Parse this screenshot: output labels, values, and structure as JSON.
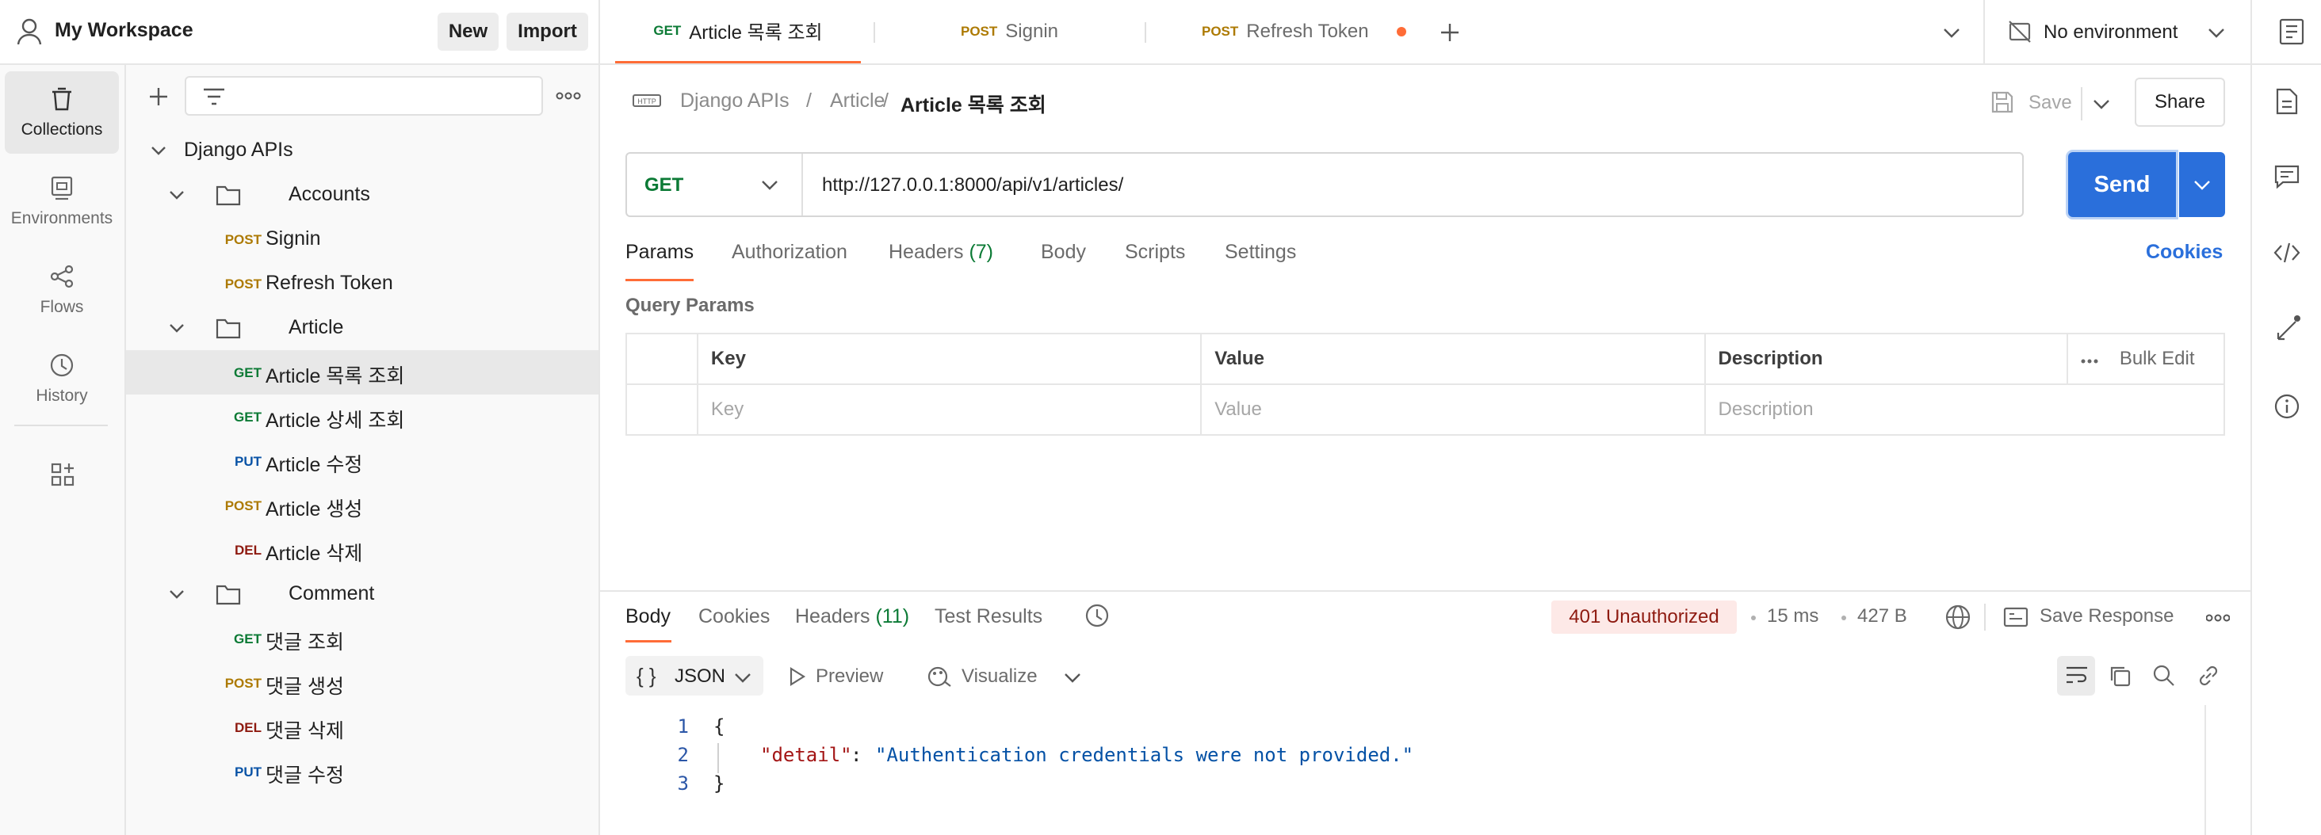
{
  "workspace": {
    "name": "My Workspace",
    "new_label": "New",
    "import_label": "Import"
  },
  "tabs": [
    {
      "method": "GET",
      "label": "Article 목록 조회"
    },
    {
      "method": "POST",
      "label": "Signin"
    },
    {
      "method": "POST",
      "label": "Refresh Token"
    }
  ],
  "environment": {
    "label": "No environment"
  },
  "rail": [
    {
      "label": "Collections",
      "icon": "trash-can-collections-icon"
    },
    {
      "label": "Environments",
      "icon": "environment-icon"
    },
    {
      "label": "Flows",
      "icon": "flows-icon"
    },
    {
      "label": "History",
      "icon": "history-icon"
    }
  ],
  "sidebar": {
    "collection": "Django APIs",
    "folders": [
      {
        "name": "Accounts",
        "requests": [
          {
            "method": "POST",
            "name": "Signin"
          },
          {
            "method": "POST",
            "name": "Refresh Token"
          }
        ]
      },
      {
        "name": "Article",
        "requests": [
          {
            "method": "GET",
            "name": "Article 목록 조회"
          },
          {
            "method": "GET",
            "name": "Article 상세 조회"
          },
          {
            "method": "PUT",
            "name": "Article 수정"
          },
          {
            "method": "POST",
            "name": "Article 생성"
          },
          {
            "method": "DEL",
            "name": "Article 삭제"
          }
        ]
      },
      {
        "name": "Comment",
        "requests": [
          {
            "method": "GET",
            "name": "댓글 조회"
          },
          {
            "method": "POST",
            "name": "댓글 생성"
          },
          {
            "method": "DEL",
            "name": "댓글 삭제"
          },
          {
            "method": "PUT",
            "name": "댓글 수정"
          }
        ]
      }
    ]
  },
  "breadcrumb": {
    "collection": "Django APIs",
    "folder": "Article",
    "request": "Article 목록 조회",
    "sep": "/"
  },
  "actions": {
    "save": "Save",
    "share": "Share"
  },
  "request": {
    "method": "GET",
    "url": "http://127.0.0.1:8000/api/v1/articles/",
    "send": "Send"
  },
  "request_tabs": {
    "params": "Params",
    "authorization": "Authorization",
    "headers": "Headers",
    "headers_count": "(7)",
    "body": "Body",
    "scripts": "Scripts",
    "settings": "Settings",
    "cookies": "Cookies"
  },
  "query_params": {
    "title": "Query Params",
    "headers": {
      "key": "Key",
      "value": "Value",
      "description": "Description",
      "bulk_edit": "Bulk Edit"
    },
    "placeholders": {
      "key": "Key",
      "value": "Value",
      "description": "Description"
    }
  },
  "response": {
    "tabs": {
      "body": "Body",
      "cookies": "Cookies",
      "headers": "Headers",
      "headers_count": "(11)",
      "test_results": "Test Results"
    },
    "status": "401 Unauthorized",
    "time": "15 ms",
    "size": "427 B",
    "save_response": "Save Response",
    "format": "JSON",
    "preview": "Preview",
    "visualize": "Visualize",
    "lines": [
      "1",
      "2",
      "3"
    ],
    "open_brace": "{",
    "close_brace": "}",
    "json_key": "\"detail\"",
    "json_colon": ":",
    "json_value": "\"Authentication credentials were not provided.\""
  },
  "colors": {
    "accent": "#ff6c37",
    "send_blue": "#2a6fdb",
    "status_bg": "#fde9e7",
    "status_text": "#8e1a10"
  }
}
